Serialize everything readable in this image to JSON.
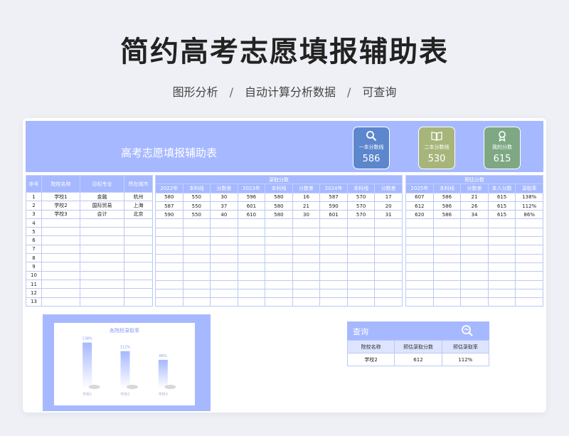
{
  "page": {
    "title": "简约高考志愿填报辅助表",
    "features": [
      "图形分析",
      "自动计算分析数据",
      "可查询"
    ],
    "separator": "/"
  },
  "banner": {
    "title": "高考志愿填报辅助表"
  },
  "kpis": [
    {
      "label": "一本分数线",
      "value": "586",
      "icon": "search-icon",
      "color": "#5d87cc"
    },
    {
      "label": "二本分数线",
      "value": "530",
      "icon": "book-icon",
      "color": "#a7b57a"
    },
    {
      "label": "我的分数",
      "value": "615",
      "icon": "award-icon",
      "color": "#7ea883"
    }
  ],
  "table_left": {
    "headers": [
      "序号",
      "院校名称",
      "目标专业",
      "所在城市"
    ],
    "rows": [
      [
        "1",
        "学校1",
        "金融",
        "杭州"
      ],
      [
        "2",
        "学校2",
        "国际贸易",
        "上海"
      ],
      [
        "3",
        "学校3",
        "会计",
        "北京"
      ],
      [
        "4",
        "",
        "",
        ""
      ],
      [
        "5",
        "",
        "",
        ""
      ],
      [
        "6",
        "",
        "",
        ""
      ],
      [
        "7",
        "",
        "",
        ""
      ],
      [
        "8",
        "",
        "",
        ""
      ],
      [
        "9",
        "",
        "",
        ""
      ],
      [
        "10",
        "",
        "",
        ""
      ],
      [
        "11",
        "",
        "",
        ""
      ],
      [
        "12",
        "",
        "",
        ""
      ],
      [
        "13",
        "",
        "",
        ""
      ]
    ]
  },
  "table_mid": {
    "group_header": "录取分数",
    "headers": [
      "2022年",
      "本科线",
      "分数差",
      "2023年",
      "本科线",
      "分数差",
      "2024年",
      "本科线",
      "分数差"
    ],
    "rows": [
      [
        "580",
        "550",
        "30",
        "596",
        "580",
        "16",
        "587",
        "570",
        "17"
      ],
      [
        "587",
        "550",
        "37",
        "601",
        "580",
        "21",
        "590",
        "570",
        "20"
      ],
      [
        "590",
        "550",
        "40",
        "610",
        "580",
        "30",
        "601",
        "570",
        "31"
      ]
    ],
    "empty_rows": 10
  },
  "table_right": {
    "group_header": "预估分数",
    "headers": [
      "2025年",
      "本科线",
      "分数差",
      "本人分数",
      "录取率"
    ],
    "rows": [
      [
        "607",
        "586",
        "21",
        "615",
        "138%"
      ],
      [
        "612",
        "586",
        "26",
        "615",
        "112%"
      ],
      [
        "620",
        "586",
        "34",
        "615",
        "86%"
      ]
    ],
    "empty_rows": 10
  },
  "chart_data": {
    "type": "bar",
    "title": "各院校录取率",
    "categories": [
      "学校1",
      "学校2",
      "学校3"
    ],
    "values": [
      138,
      112,
      86
    ],
    "value_labels": [
      "138%",
      "112%",
      "86%"
    ],
    "ylim": [
      0,
      150
    ],
    "bar_color": "#a6b8ff",
    "grid": false
  },
  "query": {
    "title": "查询",
    "icon": "search-icon",
    "headers": [
      "院校名称",
      "预估录取分数",
      "预估录取率"
    ],
    "row": [
      "学校2",
      "612",
      "112%"
    ]
  }
}
